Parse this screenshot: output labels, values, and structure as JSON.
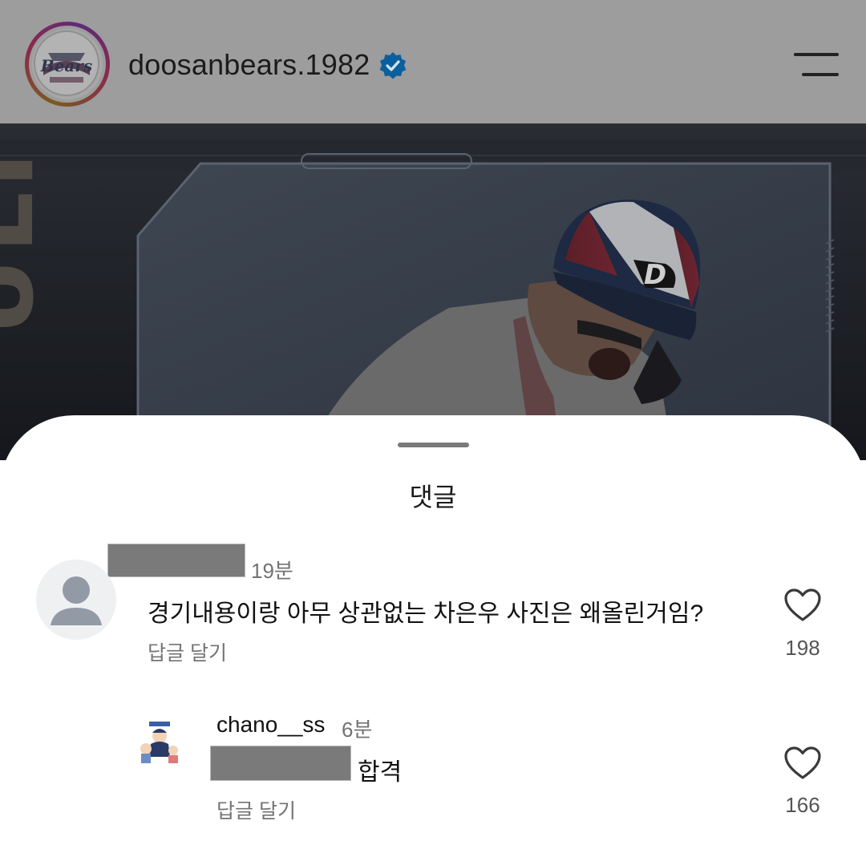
{
  "header": {
    "username": "doosanbears.1982",
    "logo_text": "Bears"
  },
  "post_image": {
    "helmet_letter": "D"
  },
  "comments_sheet": {
    "title": "댓글",
    "comments": [
      {
        "time": "19분",
        "text": "경기내용이랑 아무 상관없는 차은우 사진은 왜올린거임?",
        "reply_label": "답글 달기",
        "likes": "198"
      }
    ],
    "replies": [
      {
        "username": "chano__ss",
        "time": "6분",
        "text": "합격",
        "reply_label": "답글 달기",
        "likes": "166"
      }
    ]
  },
  "colors": {
    "verified_blue": "#0b5f9e",
    "header_dim": "#9d9d9d",
    "sheet_bg": "#ffffff",
    "secondary_text": "#737373"
  }
}
